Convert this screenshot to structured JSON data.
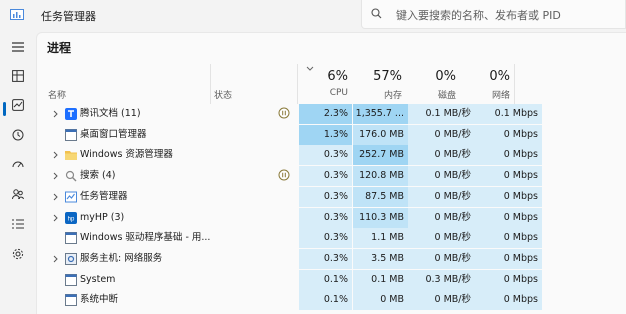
{
  "app": {
    "title": "任务管理器"
  },
  "search": {
    "placeholder": "键入要搜索的名称、发布者或 PID"
  },
  "nav": {
    "items": [
      "menu",
      "processes",
      "performance",
      "app-history",
      "startup",
      "users",
      "details",
      "services"
    ],
    "active": "processes"
  },
  "page": {
    "title": "进程"
  },
  "columns": {
    "name": "名称",
    "status": "状态",
    "cpu": {
      "pct": "6%",
      "label": "CPU"
    },
    "memory": {
      "pct": "57%",
      "label": "内存"
    },
    "disk": {
      "pct": "0%",
      "label": "磁盘"
    },
    "network": {
      "pct": "0%",
      "label": "网络"
    }
  },
  "colors": {
    "heat_low": "#d7edf9",
    "heat_mid": "#bfe3f7",
    "heat_high": "#9fd5f3",
    "accent": "#0067c0"
  },
  "rows": [
    {
      "name": "腾讯文档 (11)",
      "expandable": true,
      "icon": "tencent-docs-icon",
      "status_icon": "paused-icon",
      "cpu": "2.3%",
      "memory": "1,355.7 ...",
      "disk": "0.1 MB/秒",
      "network": "0.1 Mbps",
      "cpu_heat": "high",
      "mem_heat": "high"
    },
    {
      "name": "桌面窗口管理器",
      "expandable": false,
      "icon": "window-icon",
      "status_icon": "",
      "cpu": "1.3%",
      "memory": "176.0 MB",
      "disk": "0 MB/秒",
      "network": "0 Mbps",
      "cpu_heat": "high",
      "mem_heat": "mid"
    },
    {
      "name": "Windows 资源管理器",
      "expandable": true,
      "icon": "folder-icon",
      "status_icon": "",
      "cpu": "0.3%",
      "memory": "252.7 MB",
      "disk": "0 MB/秒",
      "network": "0 Mbps",
      "cpu_heat": "low",
      "mem_heat": "high"
    },
    {
      "name": "搜索 (4)",
      "expandable": true,
      "icon": "search-app-icon",
      "status_icon": "paused-icon",
      "cpu": "0.3%",
      "memory": "120.8 MB",
      "disk": "0 MB/秒",
      "network": "0 Mbps",
      "cpu_heat": "low",
      "mem_heat": "mid"
    },
    {
      "name": "任务管理器",
      "expandable": true,
      "icon": "task-manager-icon",
      "status_icon": "",
      "cpu": "0.3%",
      "memory": "87.5 MB",
      "disk": "0 MB/秒",
      "network": "0 Mbps",
      "cpu_heat": "low",
      "mem_heat": "mid"
    },
    {
      "name": "myHP (3)",
      "expandable": true,
      "icon": "myhp-icon",
      "status_icon": "",
      "cpu": "0.3%",
      "memory": "110.3 MB",
      "disk": "0 MB/秒",
      "network": "0 Mbps",
      "cpu_heat": "low",
      "mem_heat": "mid"
    },
    {
      "name": "Windows 驱动程序基础 - 用...",
      "expandable": false,
      "icon": "window-icon",
      "status_icon": "",
      "cpu": "0.3%",
      "memory": "1.1 MB",
      "disk": "0 MB/秒",
      "network": "0 Mbps",
      "cpu_heat": "low",
      "mem_heat": "low"
    },
    {
      "name": "服务主机: 网络服务",
      "expandable": true,
      "icon": "service-host-icon",
      "status_icon": "",
      "cpu": "0.3%",
      "memory": "3.5 MB",
      "disk": "0 MB/秒",
      "network": "0 Mbps",
      "cpu_heat": "low",
      "mem_heat": "low"
    },
    {
      "name": "System",
      "expandable": false,
      "icon": "window-icon",
      "status_icon": "",
      "cpu": "0.1%",
      "memory": "0.1 MB",
      "disk": "0.3 MB/秒",
      "network": "0 Mbps",
      "cpu_heat": "low",
      "mem_heat": "low"
    },
    {
      "name": "系统中断",
      "expandable": false,
      "icon": "window-icon",
      "status_icon": "",
      "cpu": "0.1%",
      "memory": "0 MB",
      "disk": "0 MB/秒",
      "network": "0 Mbps",
      "cpu_heat": "low",
      "mem_heat": "low"
    }
  ]
}
